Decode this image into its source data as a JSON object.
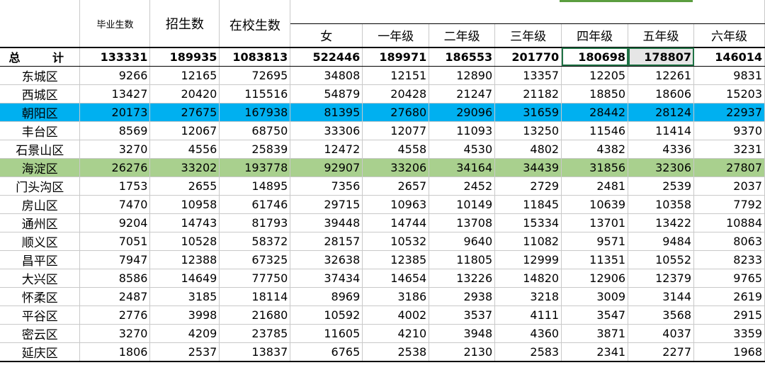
{
  "headers": {
    "graduates": "毕业生数",
    "enrolled": "招生数",
    "in_school": "在校生数",
    "sub": [
      "女",
      "一年级",
      "二年级",
      "三年级",
      "四年级",
      "五年级",
      "六年级"
    ]
  },
  "total": {
    "label": "总 计",
    "values": [
      "133331",
      "189935",
      "1083813",
      "522446",
      "189971",
      "186553",
      "201770",
      "180698",
      "178807",
      "146014"
    ]
  },
  "rows": [
    {
      "label": "东城区",
      "values": [
        "9266",
        "12165",
        "72695",
        "34808",
        "12151",
        "12890",
        "13357",
        "12205",
        "12261",
        "9831"
      ]
    },
    {
      "label": "西城区",
      "values": [
        "13427",
        "20420",
        "115516",
        "54879",
        "20428",
        "21247",
        "21182",
        "18850",
        "18606",
        "15203"
      ]
    },
    {
      "label": "朝阳区",
      "values": [
        "20173",
        "27675",
        "167938",
        "81395",
        "27680",
        "29096",
        "31659",
        "28442",
        "28124",
        "22937"
      ]
    },
    {
      "label": "丰台区",
      "values": [
        "8569",
        "12067",
        "68750",
        "33306",
        "12077",
        "11093",
        "13250",
        "11546",
        "11414",
        "9370"
      ]
    },
    {
      "label": "石景山区",
      "values": [
        "3270",
        "4556",
        "25839",
        "12472",
        "4558",
        "4530",
        "4802",
        "4382",
        "4336",
        "3231"
      ]
    },
    {
      "label": "海淀区",
      "values": [
        "26276",
        "33202",
        "193778",
        "92907",
        "33206",
        "34164",
        "34439",
        "31856",
        "32306",
        "27807"
      ]
    },
    {
      "label": "门头沟区",
      "values": [
        "1753",
        "2655",
        "14895",
        "7356",
        "2657",
        "2452",
        "2729",
        "2481",
        "2539",
        "2037"
      ]
    },
    {
      "label": "房山区",
      "values": [
        "7470",
        "10958",
        "61746",
        "29715",
        "10963",
        "10149",
        "11845",
        "10639",
        "10358",
        "7792"
      ]
    },
    {
      "label": "通州区",
      "values": [
        "9204",
        "14743",
        "81793",
        "39448",
        "14744",
        "13708",
        "15334",
        "13701",
        "13422",
        "10884"
      ]
    },
    {
      "label": "顺义区",
      "values": [
        "7051",
        "10528",
        "58372",
        "28157",
        "10532",
        "9640",
        "11082",
        "9571",
        "9484",
        "8063"
      ]
    },
    {
      "label": "昌平区",
      "values": [
        "7947",
        "12388",
        "67325",
        "32638",
        "12385",
        "11805",
        "12999",
        "11351",
        "10552",
        "8233"
      ]
    },
    {
      "label": "大兴区",
      "values": [
        "8586",
        "14649",
        "77750",
        "37434",
        "14654",
        "13226",
        "14820",
        "12906",
        "12379",
        "9765"
      ]
    },
    {
      "label": "怀柔区",
      "values": [
        "2487",
        "3185",
        "18114",
        "8969",
        "3186",
        "2938",
        "3218",
        "3009",
        "3144",
        "2619"
      ]
    },
    {
      "label": "平谷区",
      "values": [
        "2776",
        "3998",
        "21680",
        "10592",
        "4002",
        "3537",
        "4111",
        "3547",
        "3568",
        "2915"
      ]
    },
    {
      "label": "密云区",
      "values": [
        "3270",
        "4209",
        "23785",
        "11605",
        "4210",
        "3948",
        "4360",
        "3871",
        "4037",
        "3359"
      ]
    },
    {
      "label": "延庆区",
      "values": [
        "1806",
        "2537",
        "13837",
        "6765",
        "2538",
        "2130",
        "2583",
        "2341",
        "2277",
        "1968"
      ]
    }
  ],
  "highlights": {
    "blue_row": "朝阳区",
    "green_row": "海淀区",
    "blue": "#00b0f0",
    "green": "#a9d08e",
    "selection": "#217346"
  }
}
